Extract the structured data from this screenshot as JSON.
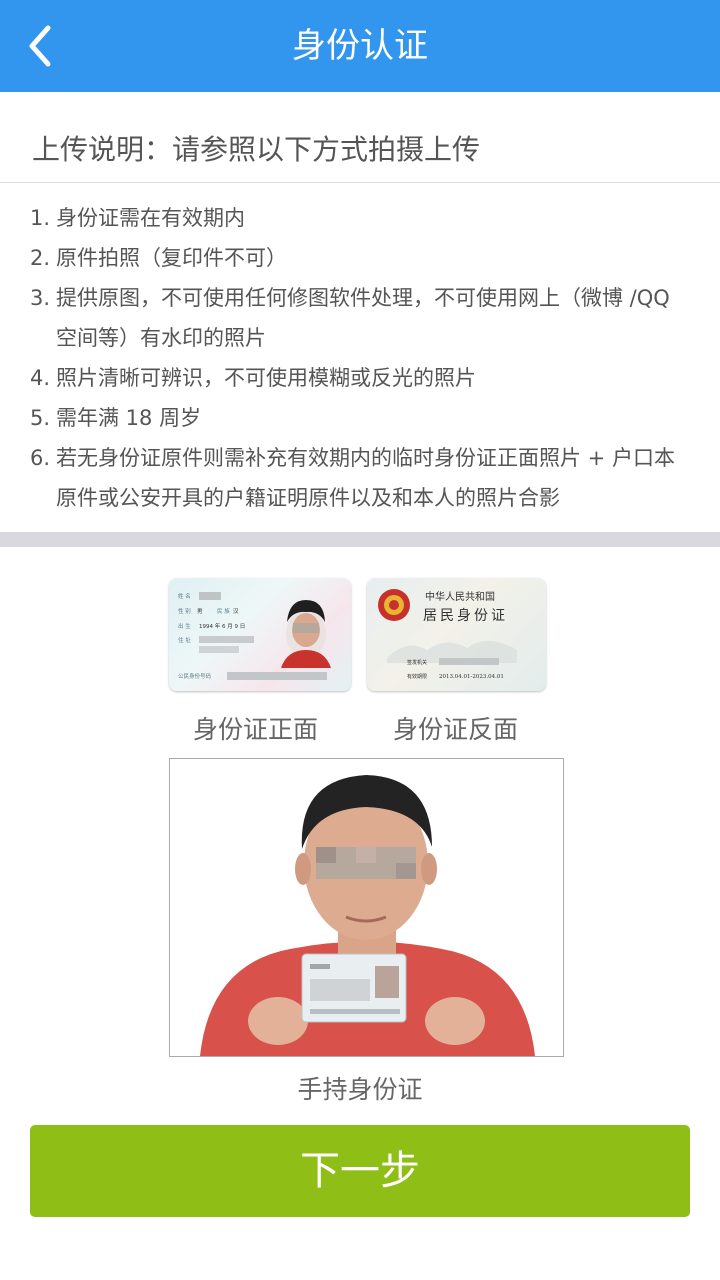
{
  "header": {
    "title": "身份认证",
    "back_icon": "chevron-left-icon"
  },
  "intro": "上传说明：请参照以下方式拍摄上传",
  "instructions": [
    {
      "num": "1.",
      "text": "身份证需在有效期内"
    },
    {
      "num": "2.",
      "text": "原件拍照（复印件不可）"
    },
    {
      "num": "3.",
      "text": "提供原图，不可使用任何修图软件处理，不可使用网上（微博 /QQ 空间等）有水印的照片"
    },
    {
      "num": "4.",
      "text": "照片清晰可辨识，不可使用模糊或反光的照片"
    },
    {
      "num": "5.",
      "text": "需年满 18 周岁"
    },
    {
      "num": "6.",
      "text": "若无身份证原件则需补充有效期内的临时身份证正面照片 + 户口本原件或公安开具的户籍证明原件以及和本人的照片合影"
    }
  ],
  "samples": {
    "front": {
      "caption": "身份证正面",
      "card_text": {
        "name": "姓 名",
        "gender_label": "性 别",
        "gender": "男",
        "ethnicity_label": "民 族",
        "ethnicity": "汉",
        "birth_label": "出 生",
        "birth": "1994 年 6 月 9 日",
        "address_label": "住 址",
        "id_label": "公民身份号码"
      }
    },
    "back": {
      "caption": "身份证反面",
      "card_text": {
        "country": "中华人民共和国",
        "title": "居民身份证",
        "authority_label": "签发机关",
        "validity_label": "有效期限",
        "validity": "2013.04.01-2023.04.01"
      }
    },
    "handheld": {
      "caption": "手持身份证"
    }
  },
  "next_button": "下一步",
  "colors": {
    "header": "#3296ef",
    "button": "#8fbe16",
    "band": "#d8d8de"
  }
}
